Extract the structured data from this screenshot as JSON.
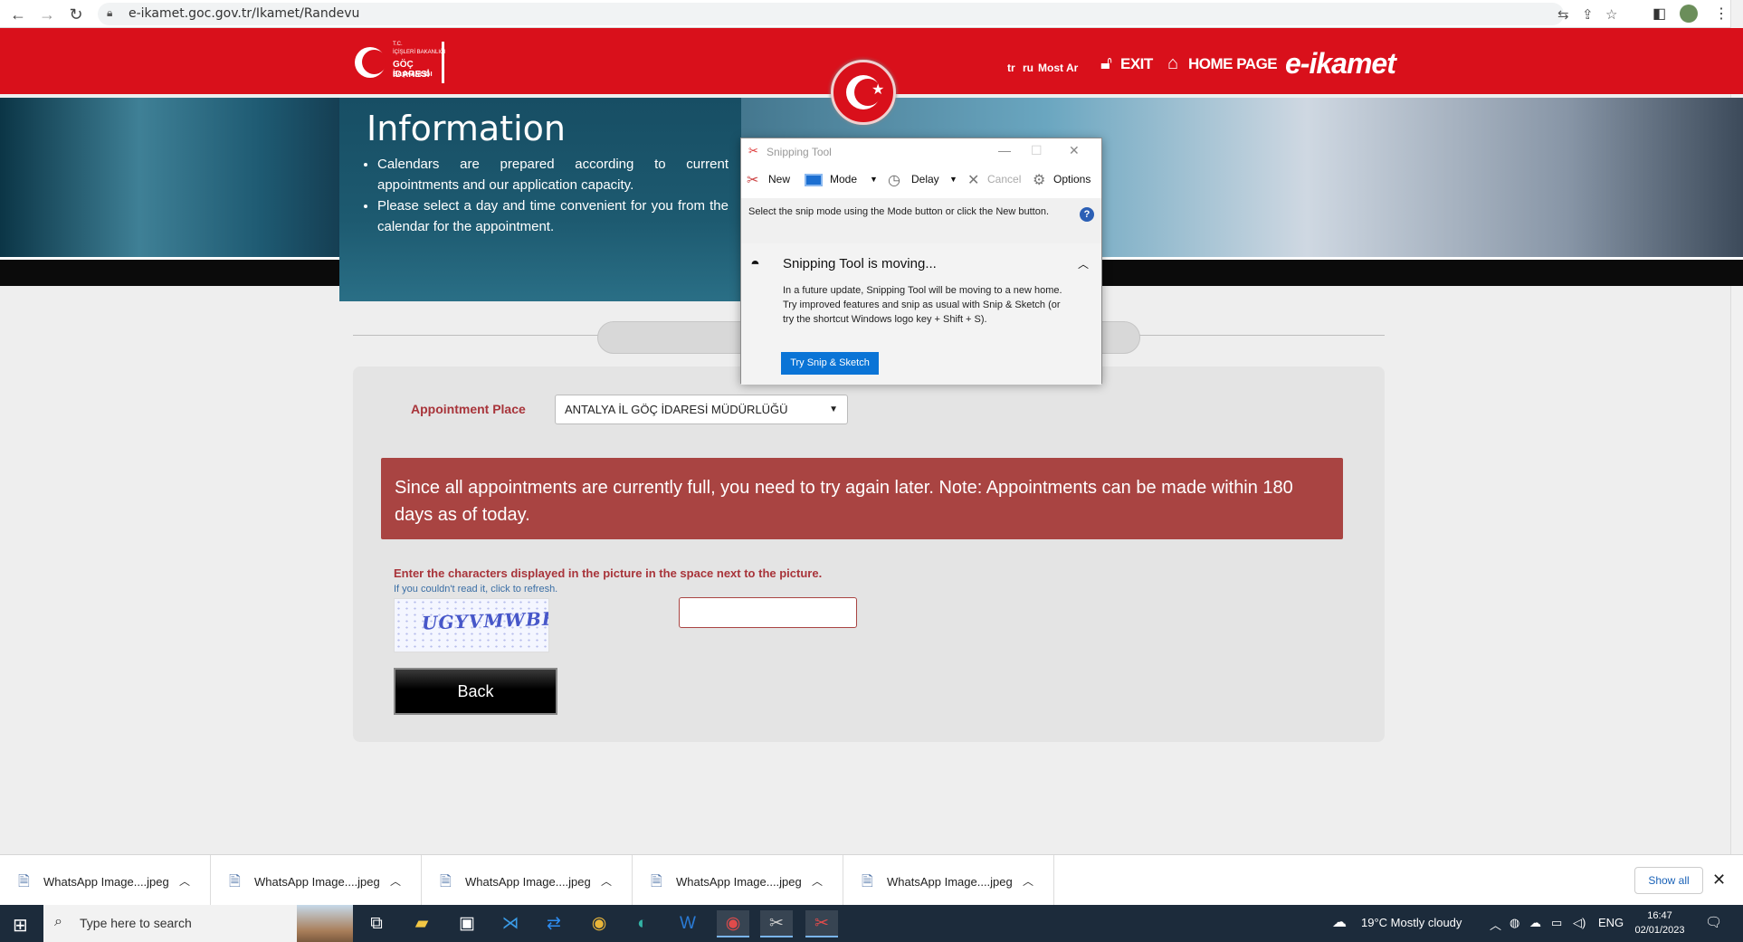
{
  "browser": {
    "url": "e-ikamet.goc.gov.tr/Ikamet/Randevu"
  },
  "header": {
    "logo_lines": [
      "T.C.",
      "İÇİŞLERİ BAKANLIĞI",
      "GÖÇ İDARESİ",
      "BAŞKANLIĞI"
    ],
    "languages": [
      "tr",
      "ru",
      "Most",
      "Ar"
    ],
    "exit_label": "EXIT",
    "home_label": "HOME PAGE",
    "brand": "e-ikamet"
  },
  "info": {
    "title": "Information",
    "items": [
      "Calendars are prepared according to current appointments and our application capacity.",
      "Please select a day and time convenient for you from the calendar for the appointment."
    ]
  },
  "form": {
    "place_label": "Appointment Place",
    "place_value": "ANTALYA İL GÖÇ İDARESİ MÜDÜRLÜĞÜ",
    "alert": "Since all appointments are currently full, you need to try again later. Note: Appointments can be made within 180 days as of today.",
    "captcha_label": "Enter the characters displayed in the picture in the space next to the picture.",
    "captcha_refresh": "If you couldn't read it, click to refresh.",
    "captcha_text": "UGYVMWBH",
    "captcha_value": "",
    "back_label": "Back"
  },
  "snipping_tool": {
    "title": "Snipping Tool",
    "toolbar": {
      "new": "New",
      "mode": "Mode",
      "delay": "Delay",
      "cancel": "Cancel",
      "options": "Options"
    },
    "help": "Select the snip mode using the Mode button or click the New button.",
    "moving_title": "Snipping Tool is moving...",
    "moving_body": "In a future update, Snipping Tool will be moving to a new home. Try improved features and snip as usual with Snip & Sketch (or try the shortcut Windows logo key + Shift + S).",
    "try_button": "Try Snip & Sketch"
  },
  "downloads": {
    "items": [
      "WhatsApp Image....jpeg",
      "WhatsApp Image....jpeg",
      "WhatsApp Image....jpeg",
      "WhatsApp Image....jpeg",
      "WhatsApp Image....jpeg"
    ],
    "show_all": "Show all"
  },
  "taskbar": {
    "search_placeholder": "Type here to search",
    "weather": "19°C  Mostly cloudy",
    "language": "ENG",
    "time": "16:47",
    "date": "02/01/2023"
  },
  "colors": {
    "brand_red": "#d9101b",
    "alert_red": "#a94442",
    "accent_blue": "#0a74d6"
  }
}
